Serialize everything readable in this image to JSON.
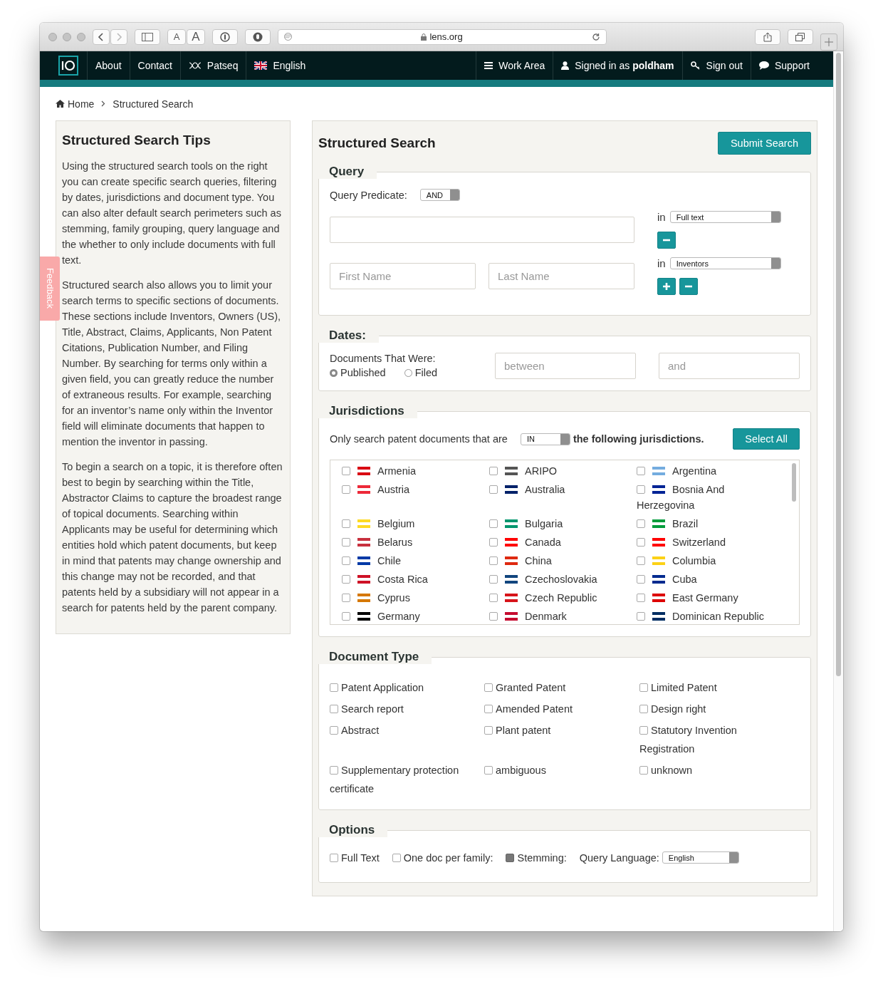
{
  "browser": {
    "font_small": "A",
    "font_large": "A",
    "url": "lens.org"
  },
  "nav": {
    "left": [
      {
        "kind": "text",
        "label": "About"
      },
      {
        "kind": "text",
        "label": "Contact"
      },
      {
        "kind": "dna",
        "label": "Patseq"
      },
      {
        "kind": "flag",
        "label": "English"
      }
    ],
    "work_area": "Work Area",
    "signed_in": "Signed in as **poldham**",
    "sign_out": "Sign out",
    "support": "Support"
  },
  "breadcrumb": [
    "Home",
    "Structured Search"
  ],
  "feedback": "Feedback",
  "tips": {
    "title": "Structured Search Tips",
    "paragraphs": [
      "Using the structured search tools on the right you can create specific search queries, filtering by dates, jurisdictions and document type. You can also alter default search perimeters such as stemming, family grouping, query language and the whether to only include documents with full text.",
      "Structured search also allows you to limit your search terms to specific sections of documents. These sections include Inventors, Owners (US), Title, Abstract, Claims, Applicants, Non Patent Citations, Publication Number, and Filing Number. By searching for terms only within a given field, you can greatly reduce the number of extraneous results. For example, searching for an inventor’s name only within the Inventor field will eliminate documents that happen to mention the inventor in passing.",
      "To begin a search on a topic, it is therefore often best to begin by searching within the Title, Abstractor Claims to capture the broadest range of topical documents. Searching within Applicants may be useful for determining which entities hold which patent documents, but keep in mind that patents may change ownership and this change may not be recorded, and that patents held by a subsidiary will not appear in a search for patents held by the parent company."
    ]
  },
  "search": {
    "title": "Structured Search",
    "submit": "Submit Search"
  },
  "query": {
    "legend": "Query",
    "predicate_label": "Query Predicate:",
    "predicate": "AND",
    "rows": [
      {
        "kind": "single",
        "in_label": "in",
        "field": "Full text",
        "can_add": false
      },
      {
        "kind": "name",
        "placeholders": [
          "First Name",
          "Last Name"
        ],
        "in_label": "in",
        "field": "Inventors",
        "can_add": true
      }
    ]
  },
  "dates": {
    "legend": "Dates:",
    "label": "Documents That Were:",
    "options": [
      {
        "label": "Published",
        "selected": true
      },
      {
        "label": "Filed",
        "selected": false
      }
    ],
    "from_placeholder": "between",
    "to_placeholder": "and"
  },
  "jurisdictions": {
    "legend": "Jurisdictions",
    "lead": "Only search patent documents that are",
    "mode": "IN",
    "tail": "the following jurisdictions.",
    "select_all": "Select All",
    "items": [
      {
        "name": "Armenia",
        "color": "#d90012",
        "checked": false
      },
      {
        "name": "ARIPO",
        "color": "#555555",
        "checked": false
      },
      {
        "name": "Argentina",
        "color": "#74acdf",
        "checked": false
      },
      {
        "name": "Austria",
        "color": "#ed2939",
        "checked": false
      },
      {
        "name": "Australia",
        "color": "#012169",
        "checked": false
      },
      {
        "name": "Bosnia And Herzegovina",
        "color": "#002395",
        "checked": false
      },
      {
        "name": "Belgium",
        "color": "#fdda24",
        "checked": false
      },
      {
        "name": "Bulgaria",
        "color": "#00966e",
        "checked": false
      },
      {
        "name": "Brazil",
        "color": "#009c3b",
        "checked": false
      },
      {
        "name": "Belarus",
        "color": "#c8313e",
        "checked": false
      },
      {
        "name": "Canada",
        "color": "#ff0000",
        "checked": false
      },
      {
        "name": "Switzerland",
        "color": "#ff0000",
        "checked": false
      },
      {
        "name": "Chile",
        "color": "#0039a6",
        "checked": false
      },
      {
        "name": "China",
        "color": "#de2910",
        "checked": false
      },
      {
        "name": "Columbia",
        "color": "#fcd116",
        "checked": false
      },
      {
        "name": "Costa Rica",
        "color": "#ce1126",
        "checked": false
      },
      {
        "name": "Czechoslovakia",
        "color": "#11457e",
        "checked": false
      },
      {
        "name": "Cuba",
        "color": "#002a8f",
        "checked": false
      },
      {
        "name": "Cyprus",
        "color": "#d57800",
        "checked": false
      },
      {
        "name": "Czech Republic",
        "color": "#d7141a",
        "checked": false
      },
      {
        "name": "East Germany",
        "color": "#dd0000",
        "checked": false
      },
      {
        "name": "Germany",
        "color": "#000000",
        "checked": false
      },
      {
        "name": "Denmark",
        "color": "#c60c30",
        "checked": false
      },
      {
        "name": "Dominican Republic",
        "color": "#002d62",
        "checked": false
      }
    ]
  },
  "document_type": {
    "legend": "Document Type",
    "items": [
      {
        "label": "Patent Application",
        "checked": false
      },
      {
        "label": "Granted Patent",
        "checked": false
      },
      {
        "label": "Limited Patent",
        "checked": false
      },
      {
        "label": "Search report",
        "checked": false
      },
      {
        "label": "Amended Patent",
        "checked": false
      },
      {
        "label": "Design right",
        "checked": false
      },
      {
        "label": "Abstract",
        "checked": false
      },
      {
        "label": "Plant patent",
        "checked": false
      },
      {
        "label": "Statutory Invention Registration",
        "checked": false
      },
      {
        "label": "Supplementary protection certificate",
        "checked": false
      },
      {
        "label": "ambiguous",
        "checked": false
      },
      {
        "label": "unknown",
        "checked": false
      }
    ]
  },
  "options": {
    "legend": "Options",
    "checks": [
      {
        "label": "Full Text",
        "checked": false
      },
      {
        "label": "One doc per family:",
        "checked": false
      },
      {
        "label": "Stemming:",
        "checked": true
      }
    ],
    "language_label": "Query Language:",
    "language": "English"
  }
}
